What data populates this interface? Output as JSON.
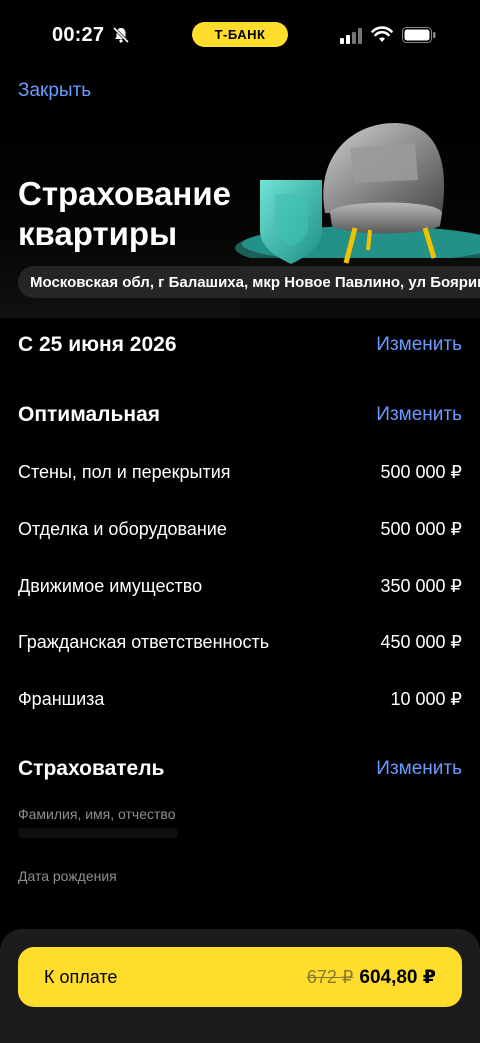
{
  "status_bar": {
    "time": "00:27",
    "carrier_badge": "Т-БАНК"
  },
  "header": {
    "close_label": "Закрыть"
  },
  "hero": {
    "title_line1": "Страхование",
    "title_line2": "квартиры",
    "address": "Московская обл, г Балашиха, мкр Новое Павлино, ул Боярин"
  },
  "start": {
    "label": "С 25 июня 2026",
    "change_label": "Изменить"
  },
  "plan": {
    "title": "Оптимальная",
    "change_label": "Изменить",
    "items": [
      {
        "label": "Стены, пол и перекрытия",
        "value": "500 000 ₽"
      },
      {
        "label": "Отделка и оборудование",
        "value": "500 000 ₽"
      },
      {
        "label": "Движимое имущество",
        "value": "350 000 ₽"
      },
      {
        "label": "Гражданская ответственность",
        "value": "450 000 ₽"
      },
      {
        "label": "Франшиза",
        "value": "10 000 ₽"
      }
    ]
  },
  "insurer": {
    "title": "Страхователь",
    "change_label": "Изменить",
    "fields": [
      {
        "label": "Фамилия, имя, отчество"
      },
      {
        "label": "Дата рождения"
      }
    ]
  },
  "payment": {
    "label": "К оплате",
    "old_price": "672 ₽",
    "price": "604,80 ₽"
  },
  "colors": {
    "accent_yellow": "#ffdd2d",
    "link_blue": "#6a9bff",
    "background": "#000000",
    "panel": "#1c1c1e"
  }
}
